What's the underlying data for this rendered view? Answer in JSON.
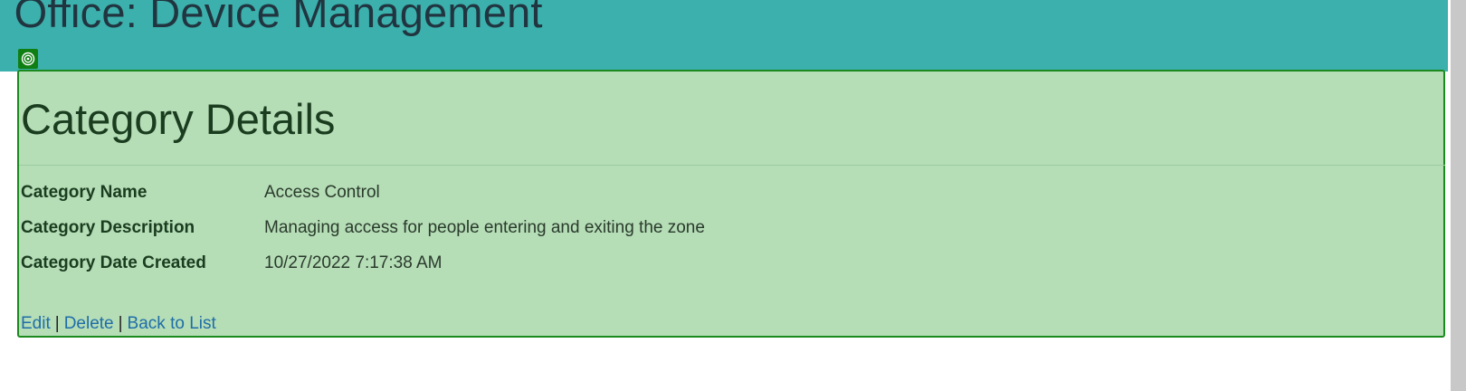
{
  "header": {
    "title": "d Office: Device Management"
  },
  "details": {
    "title": "Category Details",
    "fields": [
      {
        "label": "Category Name",
        "value": "Access Control"
      },
      {
        "label": "Category Description",
        "value": "Managing access for people entering and exiting the zone"
      },
      {
        "label": "Category Date Created",
        "value": "10/27/2022 7:17:38 AM"
      }
    ]
  },
  "actions": {
    "edit": "Edit",
    "delete": "Delete",
    "back": "Back to List",
    "separator": "|"
  },
  "colors": {
    "header_bg": "#3bb0ac",
    "highlight_bg": "#b5ddb6",
    "highlight_border": "#1b8a1e",
    "link": "#1f6ea8"
  },
  "icons": {
    "badge": "target-icon"
  }
}
